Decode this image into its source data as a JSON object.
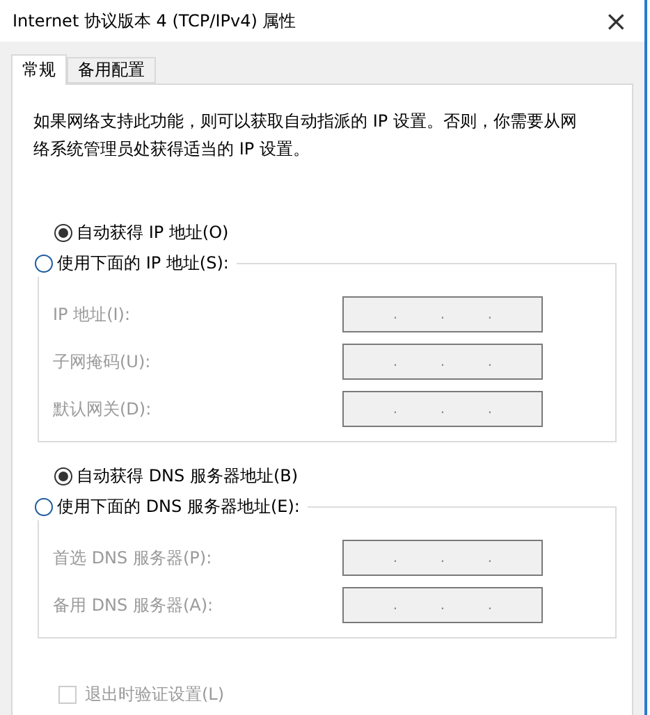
{
  "window": {
    "title": "Internet 协议版本 4 (TCP/IPv4) 属性",
    "close": "×"
  },
  "tabs": [
    {
      "label": "常规",
      "selected": true
    },
    {
      "label": "备用配置",
      "selected": false
    }
  ],
  "description": "如果网络支持此功能，则可以获取自动指派的 IP 设置。否则，你需要从网络系统管理员处获得适当的 IP 设置。",
  "sections": [
    {
      "auto_option": {
        "label": "自动获得 IP 地址(O)",
        "selected": true
      },
      "manual_option": {
        "label": "使用下面的 IP 地址(S):",
        "selected": false
      },
      "fields": [
        {
          "label": "IP 地址(I):",
          "separators": [
            ".",
            ".",
            "."
          ],
          "disabled": true
        },
        {
          "label": "子网掩码(U):",
          "separators": [
            ".",
            ".",
            "."
          ],
          "disabled": true
        },
        {
          "label": "默认网关(D):",
          "separators": [
            ".",
            ".",
            "."
          ],
          "disabled": true
        }
      ]
    },
    {
      "auto_option": {
        "label": "自动获得 DNS 服务器地址(B)",
        "selected": true
      },
      "manual_option": {
        "label": "使用下面的 DNS 服务器地址(E):",
        "selected": false
      },
      "fields": [
        {
          "label": "首选 DNS 服务器(P):",
          "separators": [
            ".",
            ".",
            "."
          ],
          "disabled": true
        },
        {
          "label": "备用 DNS 服务器(A):",
          "separators": [
            ".",
            ".",
            "."
          ],
          "disabled": true
        }
      ]
    }
  ],
  "validate": {
    "label": "退出时验证设置(L)",
    "checked": false,
    "disabled": true
  }
}
